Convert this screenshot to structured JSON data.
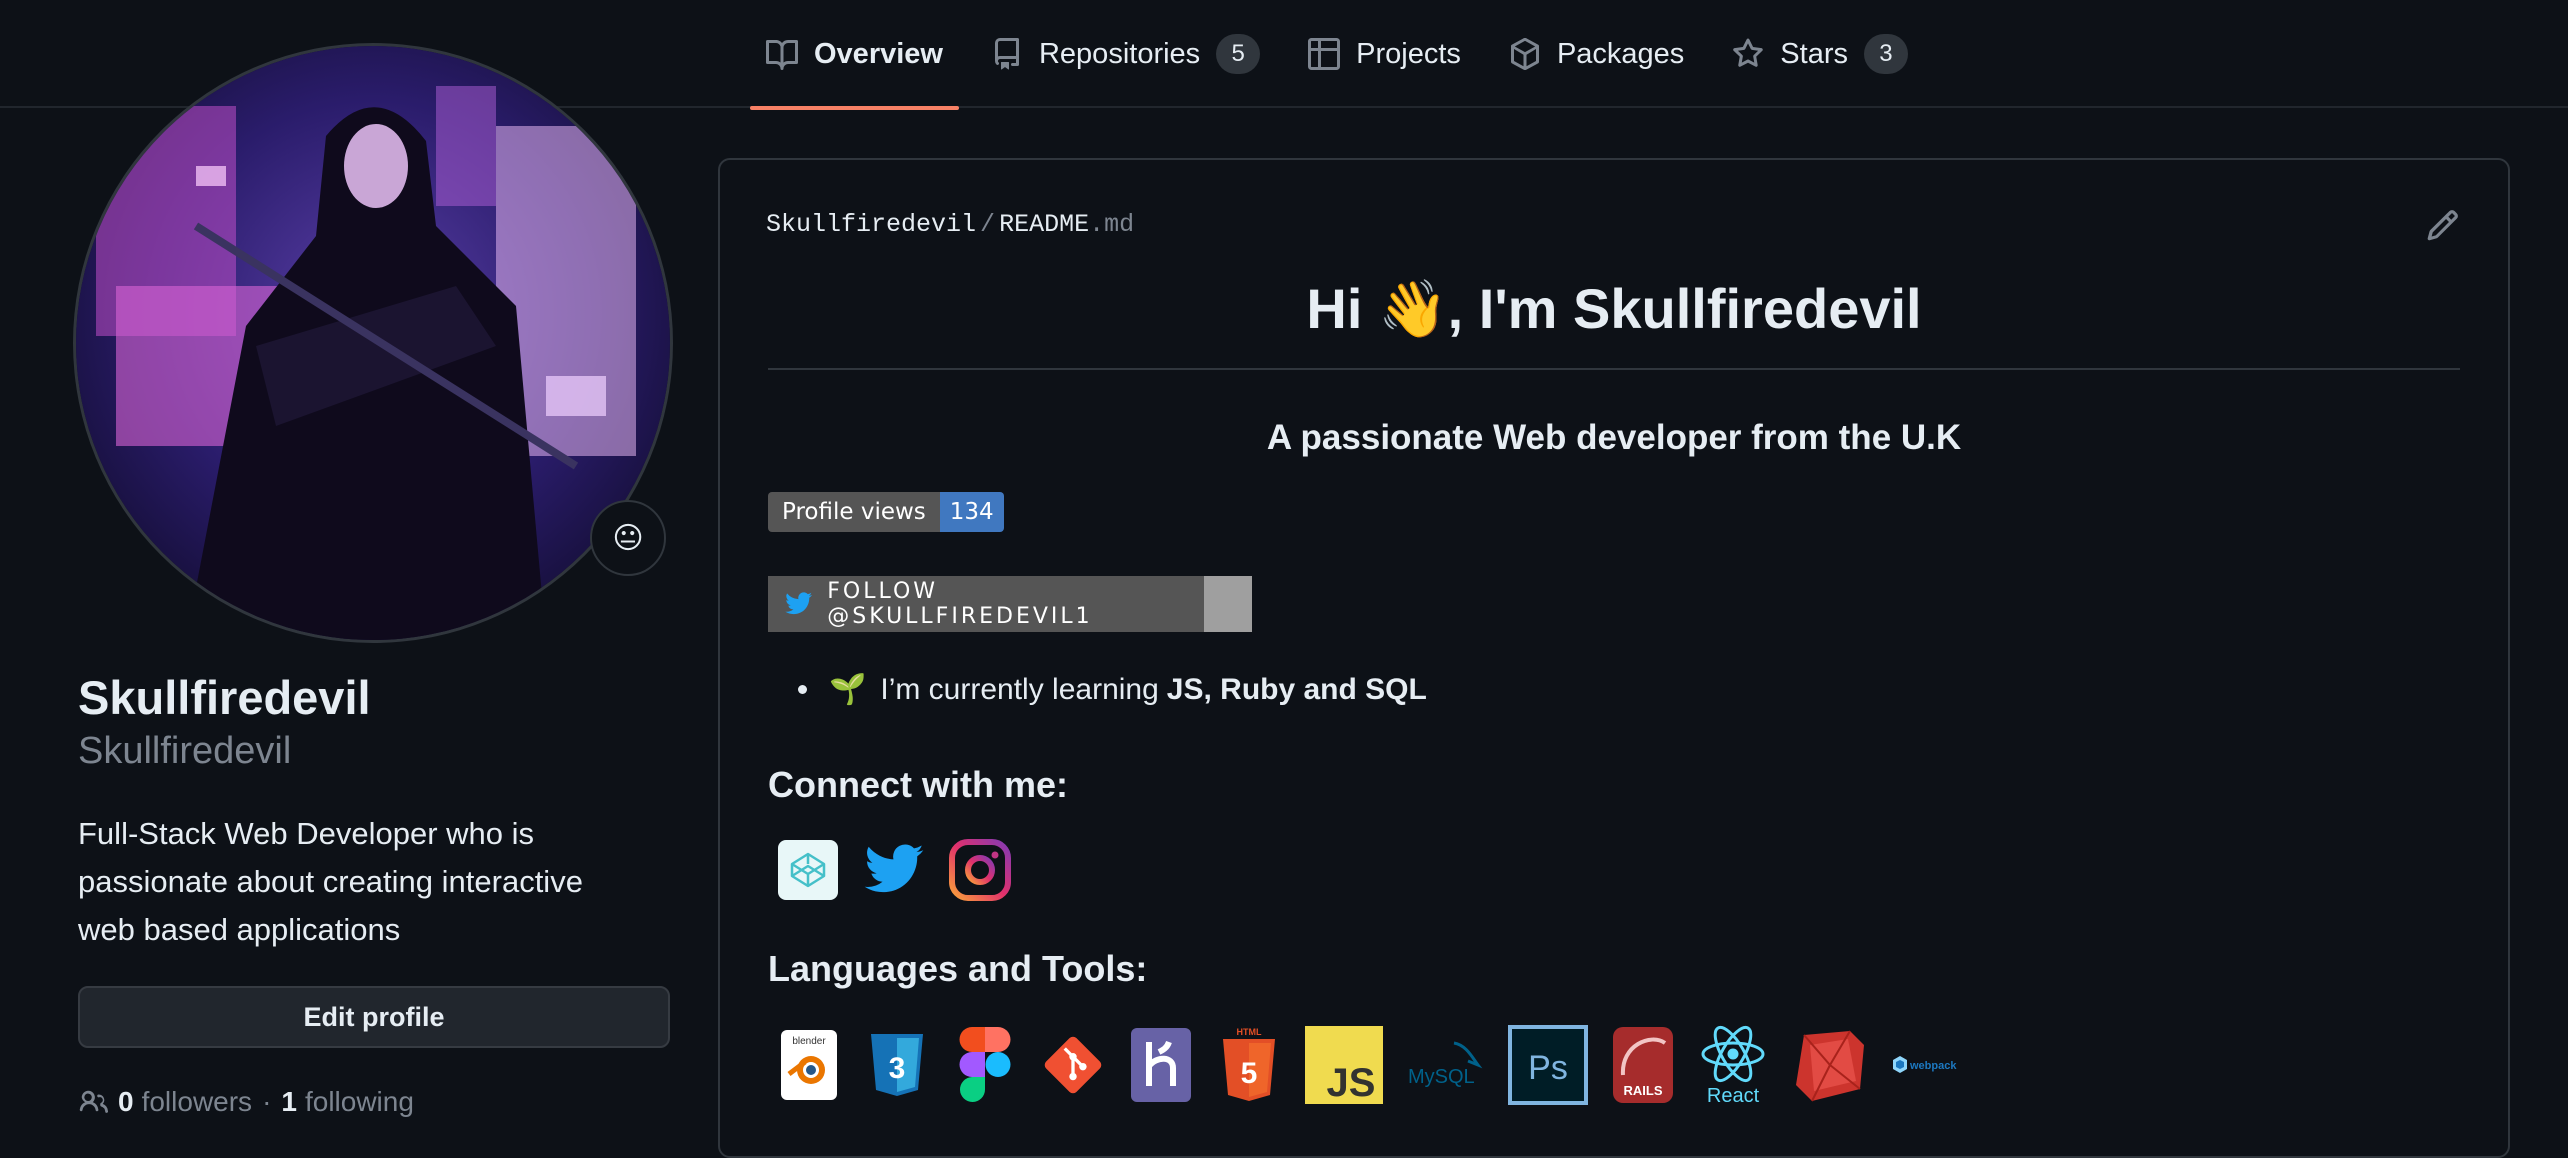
{
  "nav": {
    "tabs": [
      {
        "label": "Overview",
        "icon": "book-icon",
        "active": true
      },
      {
        "label": "Repositories",
        "icon": "repo-icon",
        "count": "5"
      },
      {
        "label": "Projects",
        "icon": "table-icon"
      },
      {
        "label": "Packages",
        "icon": "package-icon"
      },
      {
        "label": "Stars",
        "icon": "star-icon",
        "count": "3"
      }
    ]
  },
  "profile": {
    "status_emoji": "😐",
    "full_name": "Skullfiredevil",
    "login": "Skullfiredevil",
    "bio": "Full-Stack Web Developer who is passionate about creating interactive web based applications",
    "edit_label": "Edit profile",
    "followers_count": "0",
    "followers_label": "followers",
    "separator": "·",
    "following_count": "1",
    "following_label": "following"
  },
  "readme": {
    "owner": "Skullfiredevil",
    "path_sep": "/",
    "file_base": "README",
    "file_ext": ".md",
    "title": "Hi 👋, I'm Skullfiredevil",
    "subtitle": "A passionate Web developer from the U.K",
    "views_badge": {
      "label": "Profile views",
      "value": "134"
    },
    "twitter_badge": "FOLLOW @SKULLFIREDEVIL1",
    "learning_emoji": "🌱",
    "learning_text": "I’m currently learning",
    "learning_bold": "JS, Ruby and SQL",
    "connect_heading": "Connect with me:",
    "social": [
      "codepen-icon",
      "twitter-icon",
      "instagram-icon"
    ],
    "tools_heading": "Languages and Tools:",
    "tools": [
      {
        "icon": "blender-icon",
        "label": "blender"
      },
      {
        "icon": "css3-icon",
        "label": "3"
      },
      {
        "icon": "figma-icon"
      },
      {
        "icon": "git-icon"
      },
      {
        "icon": "heroku-icon"
      },
      {
        "icon": "html5-icon",
        "label": "5"
      },
      {
        "icon": "javascript-icon",
        "label": "JS"
      },
      {
        "icon": "mysql-icon",
        "label": "MySQL"
      },
      {
        "icon": "photoshop-icon",
        "label": "Ps"
      },
      {
        "icon": "rails-icon",
        "label": "RAILS"
      },
      {
        "icon": "react-icon",
        "label": "React"
      },
      {
        "icon": "ruby-icon"
      },
      {
        "icon": "webpack-icon",
        "label": "webpack"
      }
    ]
  },
  "colors": {
    "background": "#0d1117",
    "border": "#30363d",
    "accent": "#f78166",
    "muted": "#7d8590",
    "views_badge": "#4078c0"
  }
}
